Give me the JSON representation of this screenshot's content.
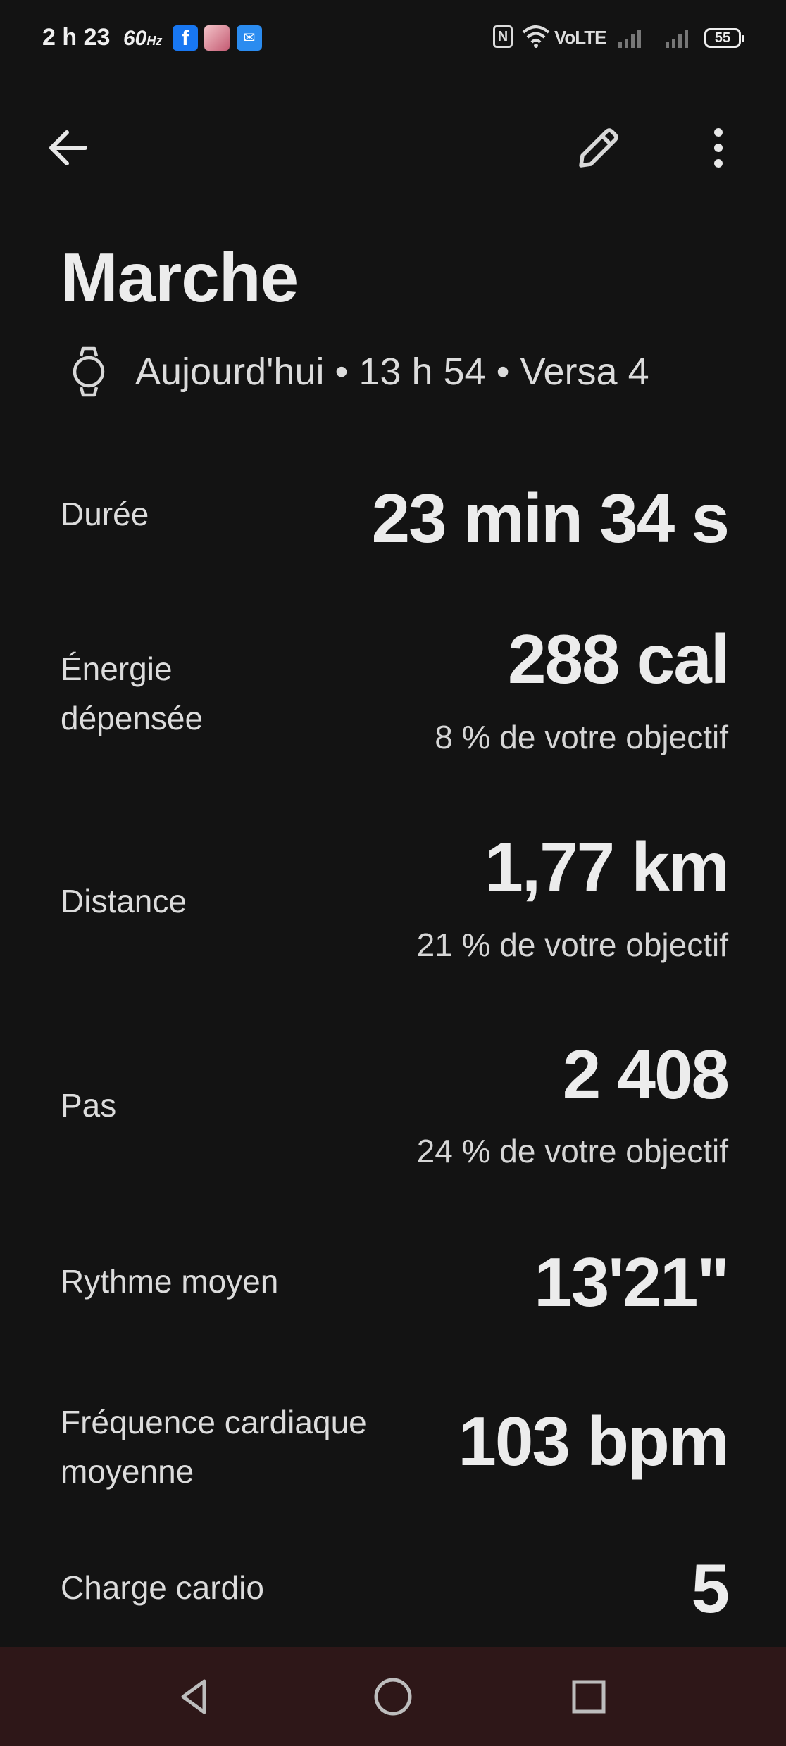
{
  "status_bar": {
    "time": "2 h 23",
    "refresh_rate": "60",
    "refresh_unit": "Hz",
    "volte": "VoLTE",
    "battery": "55",
    "icons": [
      "facebook-app-icon",
      "avatar-app-icon",
      "messenger-app-icon",
      "nfc-icon",
      "wifi-icon",
      "signal-icon",
      "battery-icon"
    ]
  },
  "toolbar": {
    "back_icon": "arrow-left-icon",
    "edit_icon": "pencil-icon",
    "more_icon": "more-vert-icon"
  },
  "activity": {
    "title": "Marche",
    "subtitle": "Aujourd'hui • 13 h 54 • Versa 4",
    "device_icon": "watch-icon"
  },
  "stats": [
    {
      "label": "Durée",
      "value": "23 min 34 s"
    },
    {
      "label_line1": "Énergie",
      "label_line2": "dépensée",
      "value": "288 cal",
      "sub": "8 % de votre objectif"
    },
    {
      "label": "Distance",
      "value": "1,77 km",
      "sub": "21 % de votre objectif"
    },
    {
      "label": "Pas",
      "value": "2 408",
      "sub": "24 % de votre objectif"
    },
    {
      "label": "Rythme moyen",
      "value": "13'21\""
    },
    {
      "label_line1": "Fréquence cardiaque",
      "label_line2": "moyenne",
      "value": "103 bpm"
    },
    {
      "label": "Charge cardio",
      "value": "5"
    }
  ],
  "colors": {
    "background": "#131313",
    "text": "#ececec",
    "navbar": "#2e1718"
  }
}
